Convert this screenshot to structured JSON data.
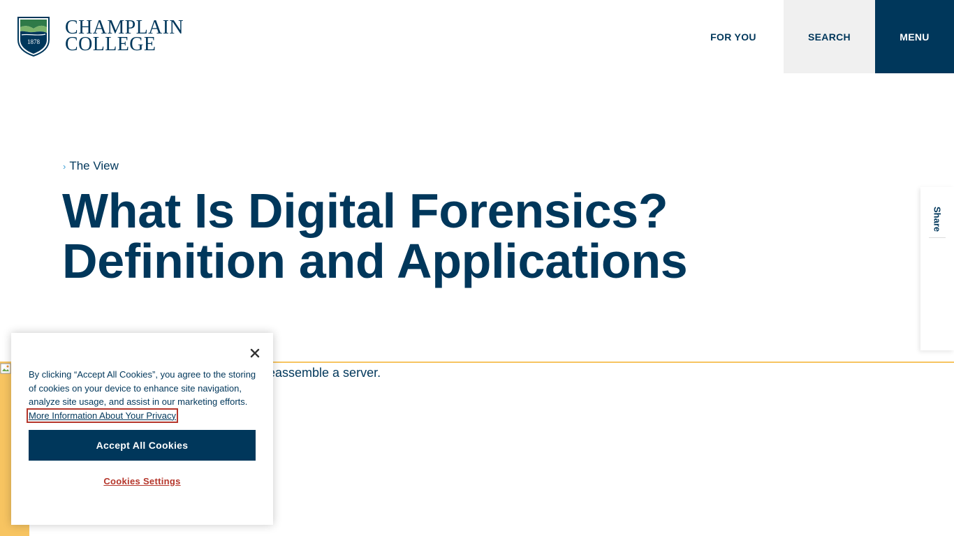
{
  "header": {
    "logo": {
      "line1": "CHAMPLAIN",
      "line2": "COLLEGE",
      "year": "1878"
    },
    "nav": {
      "for_you": "FOR YOU",
      "search": "SEARCH",
      "menu": "MENU"
    }
  },
  "breadcrumb": {
    "chevron": "›",
    "label": "The View"
  },
  "page_title": {
    "line1": "What Is Digital Forensics?",
    "line2": "Definition and Applications"
  },
  "share": {
    "label": "Share"
  },
  "hero": {
    "caption_visible": "eassemble a server.",
    "accent_color": "#f7c461"
  },
  "cookie_banner": {
    "close_icon": "close-icon",
    "text": "By clicking “Accept All Cookies”, you agree to the storing of cookies on your device to enhance site navigation, analyze site usage, and assist in our marketing efforts.",
    "link_text": "More Information About Your Privacy",
    "accept_label": "Accept All Cookies",
    "settings_label": "Cookies Settings"
  },
  "colors": {
    "brand_navy": "#00375b",
    "search_bg": "#f0f0f0",
    "accent_red": "#b5362b",
    "chevron_blue": "#3c9fd6"
  }
}
